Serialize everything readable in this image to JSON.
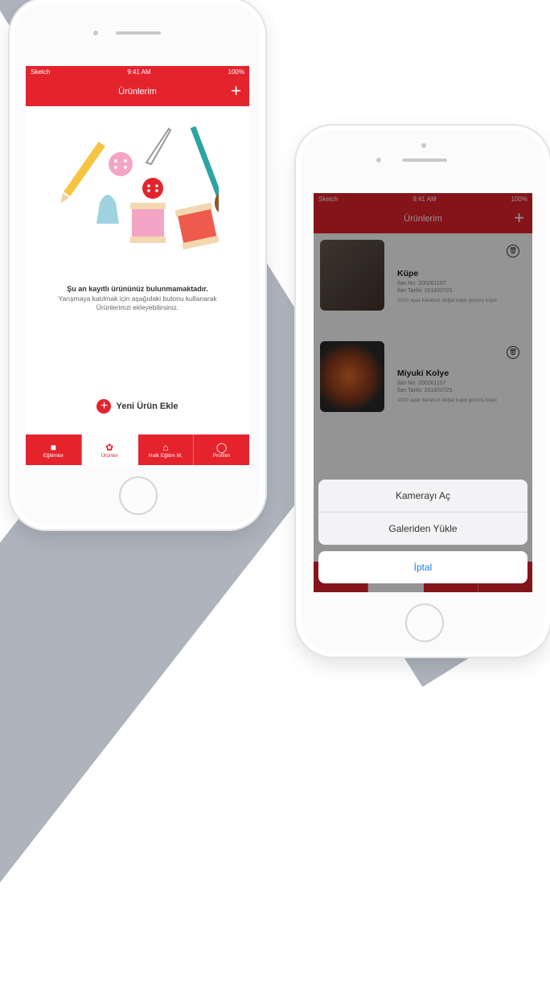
{
  "screen1": {
    "status": {
      "carrier": "Sketch",
      "time": "9:41 AM",
      "battery": "100%"
    },
    "nav": {
      "title": "Ürünlerim",
      "add": "+"
    },
    "empty": {
      "title": "Şu an kayıtlı ürününüz bulunmamaktadır.",
      "desc": "Yarışmaya katılmak için aşağıdaki butonu kullanarak Ürünlerimzi ekleyebilirsiniz."
    },
    "add_button": {
      "icon": "+",
      "label": "Yeni Ürün Ekle"
    },
    "tabs": [
      {
        "label": "Eğitimler",
        "icon": "teacher-icon"
      },
      {
        "label": "Ürünler",
        "icon": "yarn-icon"
      },
      {
        "label": "Halk Eğitim M.",
        "icon": "home-icon"
      },
      {
        "label": "Profilim",
        "icon": "user-icon"
      }
    ]
  },
  "screen2": {
    "status": {
      "carrier": "Sketch",
      "time": "9:41 AM",
      "battery": "100%"
    },
    "nav": {
      "title": "Ürünlerim",
      "add": "+"
    },
    "products": [
      {
        "name": "Küpe",
        "no": "İlan No: 200261107",
        "date": "İlan Tarihi: 2016/07/21",
        "desc": "1000 ayar karatsız doğal kaplı gümüş küpe"
      },
      {
        "name": "Miyuki Kolye",
        "no": "İlan No: 200261107",
        "date": "İlan Tarihi: 2016/07/21",
        "desc": "1000 ayar karatsız doğal kaplı gümüş küpe"
      }
    ],
    "sheet": {
      "camera": "Kamerayı Aç",
      "gallery": "Galeriden Yükle",
      "cancel": "İptal"
    }
  },
  "colors": {
    "brand": "#e4232d",
    "ios_blue": "#1c7ef3"
  }
}
